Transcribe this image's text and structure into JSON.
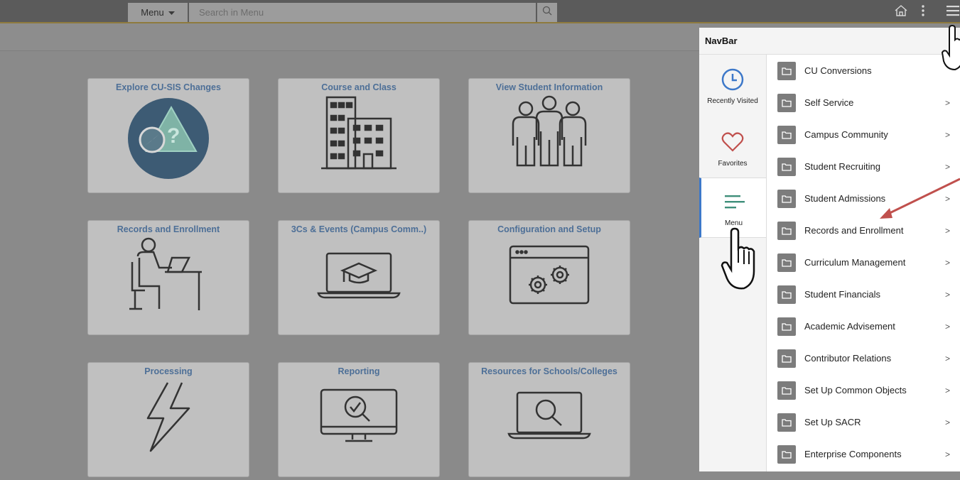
{
  "topbar": {
    "menu_label": "Menu",
    "search_placeholder": "Search in Menu",
    "icons": [
      "search-icon",
      "home-icon",
      "kebab-icon",
      "hamburger-icon"
    ]
  },
  "tiles": [
    {
      "title": "Explore CU-SIS Changes",
      "icon": "compass-question-icon"
    },
    {
      "title": "Course and Class",
      "icon": "building-icon"
    },
    {
      "title": "View Student Information",
      "icon": "people-icon"
    },
    {
      "title": "Records and Enrollment",
      "icon": "student-desk-icon"
    },
    {
      "title": "3Cs & Events (Campus Comm..)",
      "icon": "laptop-graduation-icon"
    },
    {
      "title": "Configuration and Setup",
      "icon": "gears-window-icon"
    },
    {
      "title": "Processing",
      "icon": "lightning-icon"
    },
    {
      "title": "Reporting",
      "icon": "monitor-search-icon"
    },
    {
      "title": "Resources for Schools/Colleges",
      "icon": "laptop-search-icon"
    }
  ],
  "navbar": {
    "title": "NavBar",
    "tabs": [
      {
        "label": "Recently Visited",
        "icon": "clock-icon"
      },
      {
        "label": "Favorites",
        "icon": "heart-icon"
      },
      {
        "label": "Menu",
        "icon": "menu-lines-icon",
        "active": true
      }
    ],
    "items": [
      {
        "label": "CU Conversions",
        "chevron": false
      },
      {
        "label": "Self Service",
        "chevron": true
      },
      {
        "label": "Campus Community",
        "chevron": true
      },
      {
        "label": "Student Recruiting",
        "chevron": true
      },
      {
        "label": "Student Admissions",
        "chevron": true
      },
      {
        "label": "Records and Enrollment",
        "chevron": true
      },
      {
        "label": "Curriculum Management",
        "chevron": true
      },
      {
        "label": "Student Financials",
        "chevron": true
      },
      {
        "label": "Academic Advisement",
        "chevron": true
      },
      {
        "label": "Contributor Relations",
        "chevron": true
      },
      {
        "label": "Set Up Common Objects",
        "chevron": true
      },
      {
        "label": "Set Up SACR",
        "chevron": true
      },
      {
        "label": "Enterprise Components",
        "chevron": true
      }
    ],
    "chevron_char": ">"
  },
  "colors": {
    "tile_title": "#4d6f97",
    "active_tab_accent": "#3d78c9",
    "annotation_arrow": "#c0504d",
    "folder_icon": "#7c7c7c"
  },
  "annotations": [
    "hand-pointer-icon",
    "red-arrow"
  ]
}
